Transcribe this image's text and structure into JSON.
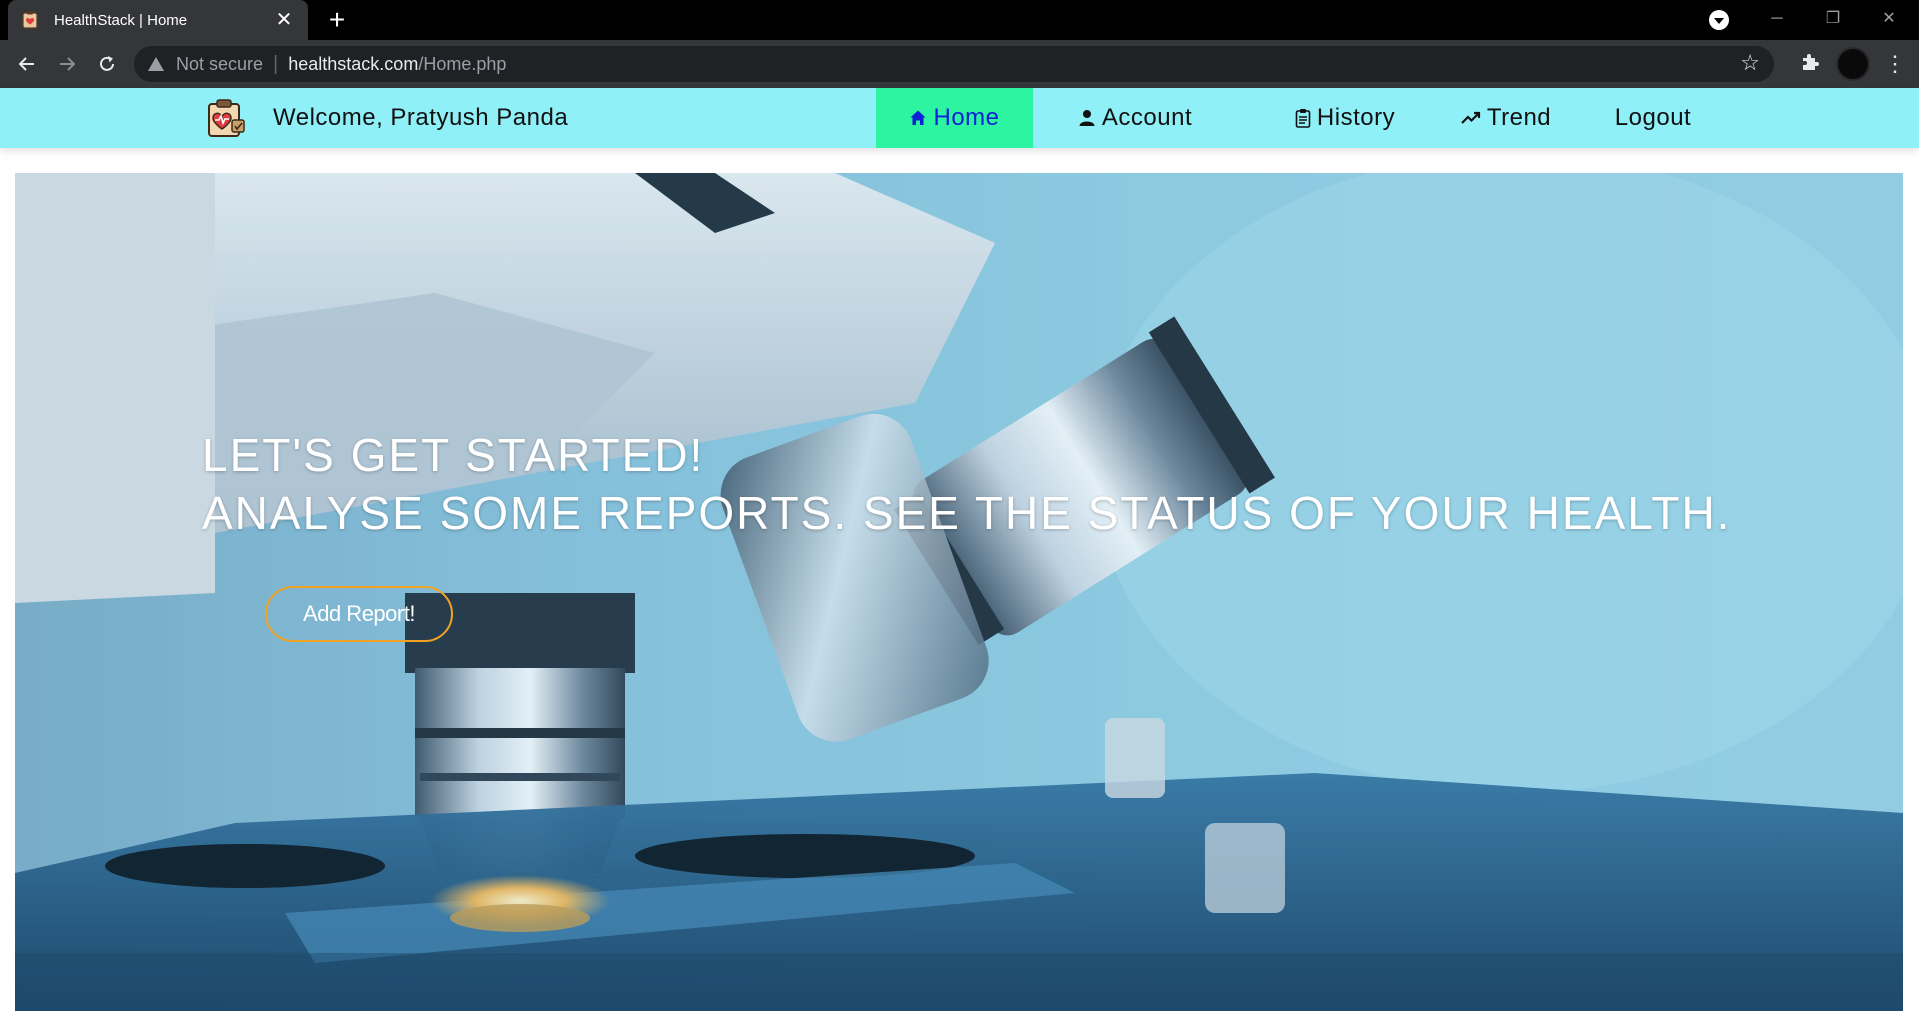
{
  "browser": {
    "tab_title": "HealthStack | Home",
    "tab_close": "✕",
    "new_tab": "+",
    "security_label": "Not secure",
    "url_host": "healthstack.com",
    "url_path": "/Home.php",
    "window_controls": {
      "minimize": "─",
      "restore": "❐",
      "close": "✕"
    }
  },
  "navbar": {
    "welcome": "Welcome, Pratyush Panda",
    "items": [
      {
        "label": "Home",
        "icon": "home-icon",
        "active": true
      },
      {
        "label": "Account",
        "icon": "user-icon",
        "active": false
      },
      {
        "label": "History",
        "icon": "clipboard-icon",
        "active": false
      },
      {
        "label": "Trend",
        "icon": "trend-up-icon",
        "active": false
      },
      {
        "label": "Logout",
        "icon": "",
        "active": false
      }
    ],
    "colors": {
      "background": "#8ff0f8",
      "active_background": "#2cf4a0",
      "active_text": "#0d21d8"
    }
  },
  "hero": {
    "line1": "LET'S GET STARTED!",
    "line2": "ANALYSE SOME REPORTS. SEE THE STATUS OF YOUR HEALTH.",
    "button_label": "Add Report!",
    "button_border_color": "#f0a323"
  }
}
